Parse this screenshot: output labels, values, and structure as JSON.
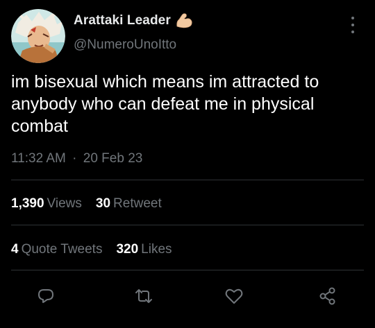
{
  "tweet": {
    "display_name": "Arattaki Leader",
    "badge_icon": "flexed-biceps-emoji",
    "handle": "@NumeroUnoItto",
    "text": "im bisexual which means im attracted to anybody who can defeat me in physical combat",
    "time": "11:32 AM",
    "separator": "·",
    "date": "20 Feb 23"
  },
  "stats_row1": [
    {
      "value": "1,390",
      "label": "Views"
    },
    {
      "value": "30",
      "label": "Retweet"
    }
  ],
  "stats_row2": [
    {
      "value": "4",
      "label": "Quote Tweets"
    },
    {
      "value": "320",
      "label": "Likes"
    }
  ],
  "actions": [
    "reply-icon",
    "retweet-icon",
    "like-icon",
    "share-icon"
  ],
  "colors": {
    "background": "#000000",
    "text": "#e7e9ea",
    "muted": "#71767b",
    "divider": "#2f3336"
  }
}
